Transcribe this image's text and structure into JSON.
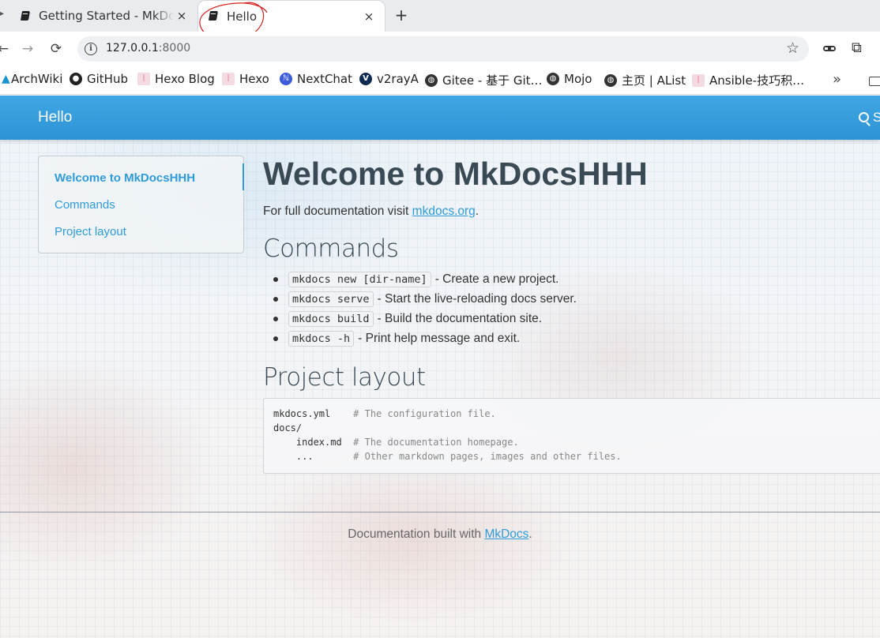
{
  "browser": {
    "tabs": [
      {
        "title": "Getting Started - MkDocs",
        "close": "×"
      },
      {
        "title": "Hello",
        "close": "×"
      }
    ],
    "new_tab": "+",
    "nav": {
      "back": "←",
      "forward": "→",
      "reload": "⟳"
    },
    "url_host": "127.0.0.1",
    "url_port": ":8000",
    "bookmarks": [
      {
        "label": "ArchWiki",
        "icon": "archlinux-icon"
      },
      {
        "label": "GitHub",
        "icon": "github-icon"
      },
      {
        "label": "Hexo Blog",
        "icon": "hexo-icon"
      },
      {
        "label": "Hexo",
        "icon": "hexo-icon"
      },
      {
        "label": "NextChat",
        "icon": "nextchat-icon"
      },
      {
        "label": "v2rayA",
        "icon": "v2raya-icon"
      },
      {
        "label": "Gitee - 基于 Git…",
        "icon": "globe-icon"
      },
      {
        "label": "Mojo",
        "icon": "globe-icon"
      },
      {
        "label": "主页 | AList",
        "icon": "globe-icon"
      },
      {
        "label": "Ansible-技巧积…",
        "icon": "hexo-icon"
      }
    ],
    "more": "»"
  },
  "site": {
    "brand": "Hello",
    "search_label": "Search",
    "accent": "#2f9bd8"
  },
  "toc": {
    "items": [
      {
        "label": "Welcome to MkDocsHHH",
        "active": true
      },
      {
        "label": "Commands",
        "active": false
      },
      {
        "label": "Project layout",
        "active": false
      }
    ]
  },
  "content": {
    "title": "Welcome to MkDocsHHH",
    "lead_prefix": "For full documentation visit ",
    "lead_link": "mkdocs.org",
    "lead_suffix": ".",
    "commands_heading": "Commands",
    "commands": [
      {
        "code": "mkdocs new [dir-name]",
        "desc": "- Create a new project."
      },
      {
        "code": "mkdocs serve",
        "desc": "- Start the live-reloading docs server."
      },
      {
        "code": "mkdocs build",
        "desc": "- Build the documentation site."
      },
      {
        "code": "mkdocs -h",
        "desc": "- Print help message and exit."
      }
    ],
    "layout_heading": "Project layout",
    "layout_lines": [
      {
        "text": "mkdocs.yml    ",
        "comment": "# The configuration file."
      },
      {
        "text": "docs/",
        "comment": ""
      },
      {
        "text": "    index.md  ",
        "comment": "# The documentation homepage."
      },
      {
        "text": "    ...       ",
        "comment": "# Other markdown pages, images and other files."
      }
    ]
  },
  "footer": {
    "prefix": "Documentation built with ",
    "link": "MkDocs",
    "suffix": "."
  }
}
